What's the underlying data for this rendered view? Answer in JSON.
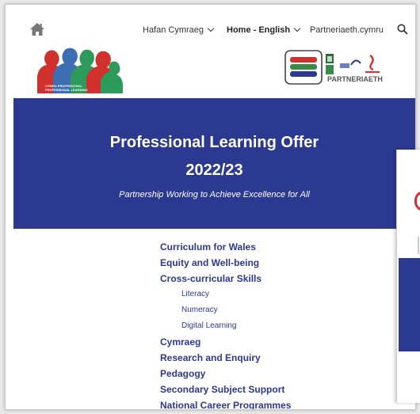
{
  "nav": {
    "cymraeg_label": "Hafan Cymraeg",
    "english_label": "Home - English",
    "site_label": "Partneriaeth.cymru"
  },
  "logos": {
    "left_text_line1": "CYMRU PROFFESIYNOL",
    "left_text_line2": "PROFESSIONAL LEARNING",
    "right_text": "PARTNERIAETH"
  },
  "banner": {
    "title": "Professional Learning Offer",
    "year": "2022/23",
    "tagline": "Partnership Working to Achieve Excellence for All",
    "color": "#2b3990"
  },
  "menu": {
    "items": [
      {
        "label": "Curriculum for Wales",
        "level": 1
      },
      {
        "label": "Equity and Well-being",
        "level": 1
      },
      {
        "label": "Cross-curricular Skills",
        "level": 1
      },
      {
        "label": "Literacy",
        "level": 2
      },
      {
        "label": "Numeracy",
        "level": 2
      },
      {
        "label": "Digital Learning",
        "level": 2
      },
      {
        "label": "Cymraeg",
        "level": 1
      },
      {
        "label": "Research and Enquiry",
        "level": 1
      },
      {
        "label": "Pedagogy",
        "level": 1
      },
      {
        "label": "Secondary Subject Support",
        "level": 1
      },
      {
        "label": "National Career Programmes",
        "level": 1
      }
    ]
  },
  "colors": {
    "accent": "#2b3990",
    "red": "#d0312d",
    "green": "#3a8a4a"
  }
}
